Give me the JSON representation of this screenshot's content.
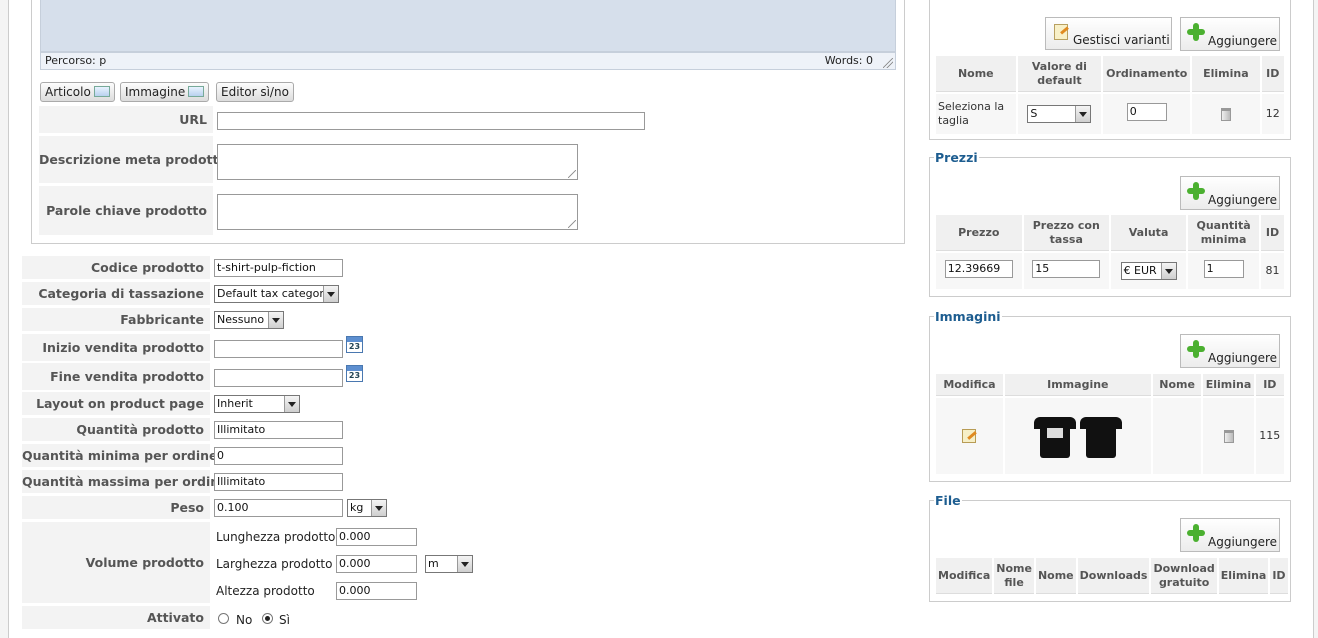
{
  "editor": {
    "path_label": "Percorso: p",
    "words_label": "Words: 0",
    "buttons": {
      "article": "Articolo",
      "image": "Immagine",
      "editor_toggle": "Editor sì/no"
    }
  },
  "meta": {
    "url_label": "URL",
    "url_value": "",
    "description_label": "Descrizione meta prodotto",
    "keywords_label": "Parole chiave prodotto"
  },
  "form": {
    "code_label": "Codice prodotto",
    "code_value": "t-shirt-pulp-fiction",
    "tax_label": "Categoria di tassazione",
    "tax_value": "Default tax category",
    "manufacturer_label": "Fabbricante",
    "manufacturer_value": "Nessuno",
    "sale_start_label": "Inizio vendita prodotto",
    "sale_end_label": "Fine vendita prodotto",
    "calendar_day": "23",
    "layout_label": "Layout on product page",
    "layout_value": "Inherit",
    "quantity_label": "Quantità prodotto",
    "quantity_value": "Illimitato",
    "min_qty_label": "Quantità minima per ordine",
    "min_qty_value": "0",
    "max_qty_label": "Quantità massima per ordine",
    "max_qty_value": "Illimitato",
    "weight_label": "Peso",
    "weight_value": "0.100",
    "weight_unit": "kg",
    "volume_label": "Volume prodotto",
    "length_label": "Lunghezza prodotto",
    "length_value": "0.000",
    "width_label": "Larghezza prodotto",
    "width_value": "0.000",
    "height_label": "Altezza prodotto",
    "height_value": "0.000",
    "dimension_unit": "m",
    "active_label": "Attivato",
    "active_no": "No",
    "active_yes": "Sì",
    "active_selected": "Sì"
  },
  "variants": {
    "manage_label": "Gestisci varianti",
    "add_label": "Aggiungere",
    "headers": [
      "Nome",
      "Valore di default",
      "Ordinamento",
      "Elimina",
      "ID"
    ],
    "row": {
      "name": "Seleziona la taglia",
      "default": "S",
      "order": "0",
      "id": "12"
    }
  },
  "prices": {
    "legend": "Prezzi",
    "add_label": "Aggiungere",
    "headers": [
      "Prezzo",
      "Prezzo con tassa",
      "Valuta",
      "Quantità minima",
      "ID"
    ],
    "row": {
      "price": "12.39669",
      "price_tax": "15",
      "currency": "€ EUR",
      "min_qty": "1",
      "id": "81"
    }
  },
  "images": {
    "legend": "Immagini",
    "add_label": "Aggiungere",
    "headers": [
      "Modifica",
      "Immagine",
      "Nome",
      "Elimina",
      "ID"
    ],
    "row": {
      "name": "",
      "id": "115"
    }
  },
  "files": {
    "legend": "File",
    "add_label": "Aggiungere",
    "headers": [
      "Modifica",
      "Nome file",
      "Nome",
      "Downloads",
      "Download gratuito",
      "Elimina",
      "ID"
    ]
  },
  "colors": {
    "legend": "#1d5d90",
    "editor_bg": "#d6dfeb",
    "add_icon": "#4bb030"
  }
}
